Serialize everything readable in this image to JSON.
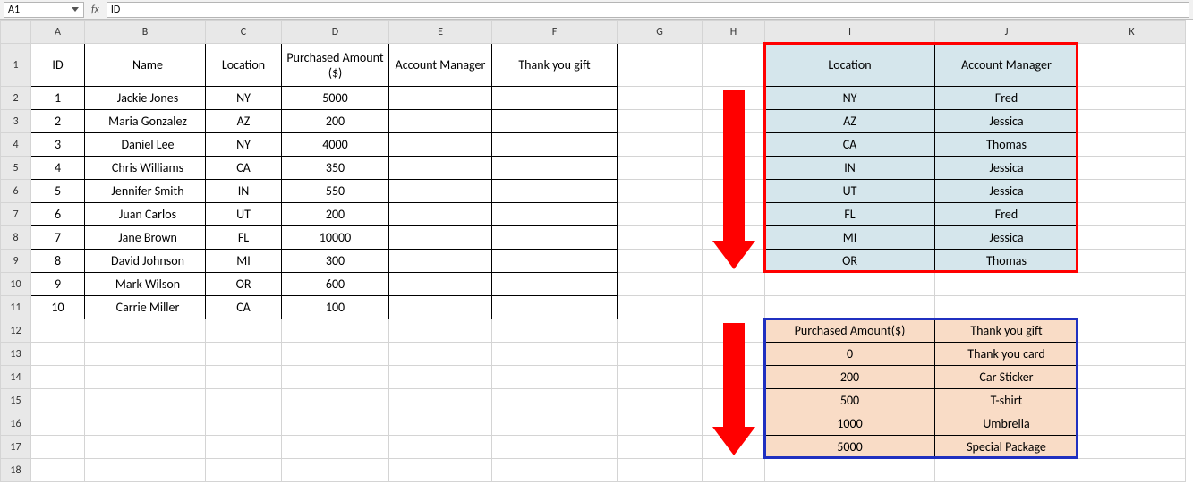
{
  "formula_bar": {
    "name_box": "A1",
    "fx_label": "fx",
    "formula": "ID"
  },
  "col_headers": [
    "A",
    "B",
    "C",
    "D",
    "E",
    "F",
    "G",
    "H",
    "I",
    "J",
    "K"
  ],
  "row_headers": [
    "1",
    "2",
    "3",
    "4",
    "5",
    "6",
    "7",
    "8",
    "9",
    "10",
    "11",
    "12",
    "13",
    "14",
    "15",
    "16",
    "17",
    "18"
  ],
  "main_table": {
    "headers": {
      "id": "ID",
      "name": "Name",
      "location": "Location",
      "purchased": "Purchased Amount ($)",
      "manager": "Account Manager",
      "gift": "Thank you gift"
    },
    "rows": [
      {
        "id": "1",
        "name": "Jackie Jones",
        "loc": "NY",
        "amt": "5000"
      },
      {
        "id": "2",
        "name": "Maria Gonzalez",
        "loc": "AZ",
        "amt": "200"
      },
      {
        "id": "3",
        "name": "Daniel Lee",
        "loc": "NY",
        "amt": "4000"
      },
      {
        "id": "4",
        "name": "Chris Williams",
        "loc": "CA",
        "amt": "350"
      },
      {
        "id": "5",
        "name": "Jennifer Smith",
        "loc": "IN",
        "amt": "550"
      },
      {
        "id": "6",
        "name": "Juan Carlos",
        "loc": "UT",
        "amt": "200"
      },
      {
        "id": "7",
        "name": "Jane Brown",
        "loc": "FL",
        "amt": "10000"
      },
      {
        "id": "8",
        "name": "David Johnson",
        "loc": "MI",
        "amt": "300"
      },
      {
        "id": "9",
        "name": "Mark Wilson",
        "loc": "OR",
        "amt": "600"
      },
      {
        "id": "10",
        "name": "Carrie Miller",
        "loc": "CA",
        "amt": "100"
      }
    ]
  },
  "lookup_blue": {
    "headers": {
      "loc": "Location",
      "mgr": "Account Manager"
    },
    "rows": [
      {
        "loc": "NY",
        "mgr": "Fred"
      },
      {
        "loc": "AZ",
        "mgr": "Jessica"
      },
      {
        "loc": "CA",
        "mgr": "Thomas"
      },
      {
        "loc": "IN",
        "mgr": "Jessica"
      },
      {
        "loc": "UT",
        "mgr": "Jessica"
      },
      {
        "loc": "FL",
        "mgr": "Fred"
      },
      {
        "loc": "MI",
        "mgr": "Jessica"
      },
      {
        "loc": "OR",
        "mgr": "Thomas"
      }
    ]
  },
  "lookup_peach": {
    "headers": {
      "amt": "Purchased Amount($)",
      "gift": "Thank you gift"
    },
    "rows": [
      {
        "amt": "0",
        "gift": "Thank you card"
      },
      {
        "amt": "200",
        "gift": "Car Sticker"
      },
      {
        "amt": "500",
        "gift": "T-shirt"
      },
      {
        "amt": "1000",
        "gift": "Umbrella"
      },
      {
        "amt": "5000",
        "gift": "Special Package"
      }
    ]
  },
  "arrows": {
    "color": "#ff0000"
  },
  "outline_red": "#ff0000",
  "outline_blue": "#2030c0"
}
